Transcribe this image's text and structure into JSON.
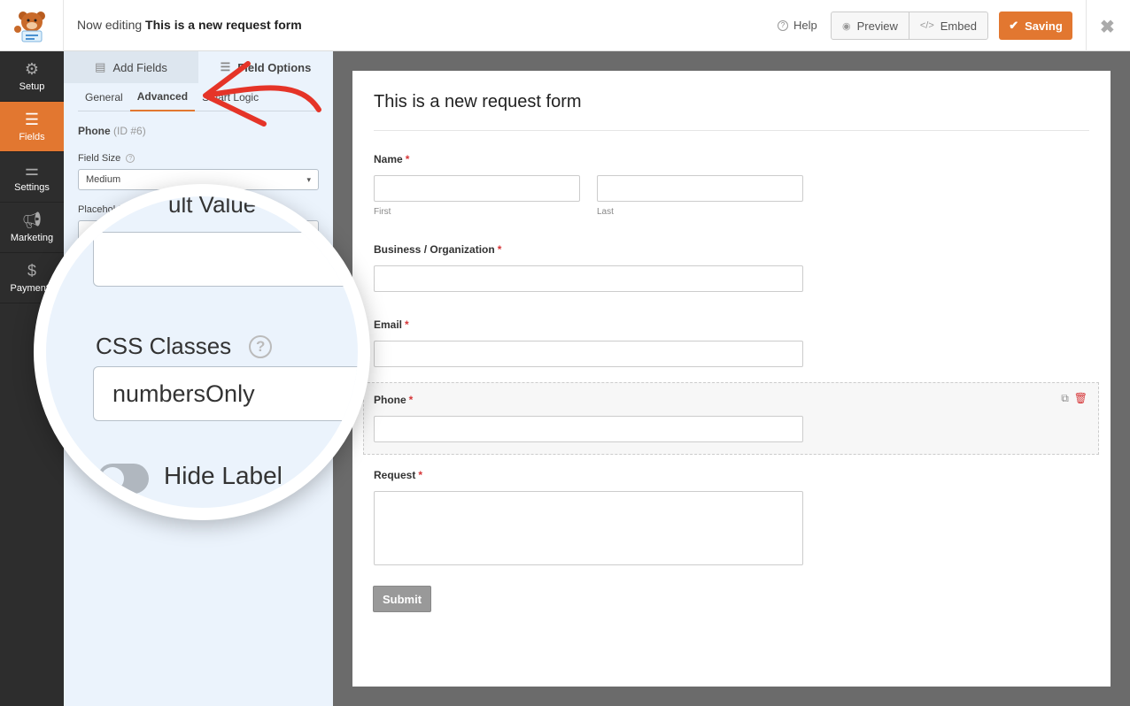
{
  "header": {
    "editing_prefix": "Now editing",
    "form_name": "This is a new request form",
    "help_label": "Help",
    "preview_label": "Preview",
    "embed_label": "Embed",
    "saving_label": "Saving",
    "accent_color": "#e27730"
  },
  "nav": {
    "items": [
      {
        "label": "Setup",
        "icon": "gear-icon"
      },
      {
        "label": "Fields",
        "icon": "fields-icon",
        "active": true
      },
      {
        "label": "Settings",
        "icon": "sliders-icon"
      },
      {
        "label": "Marketing",
        "icon": "megaphone-icon"
      },
      {
        "label": "Payments",
        "icon": "dollar-icon"
      }
    ]
  },
  "panel": {
    "tabs": [
      {
        "label": "Add Fields"
      },
      {
        "label": "Field Options",
        "active": true
      }
    ],
    "subtabs": [
      {
        "label": "General"
      },
      {
        "label": "Advanced",
        "active": true
      },
      {
        "label": "Smart Logic"
      }
    ],
    "field_name": "Phone",
    "field_id": "(ID #6)",
    "field_size_label": "Field Size",
    "field_size_value": "Medium",
    "placeholder_label": "Placeholder Text"
  },
  "magnifier": {
    "partial_text": "ult Value",
    "css_classes_label": "CSS Classes",
    "css_classes_value": "numbersOnly",
    "hide_label": "Hide Label"
  },
  "form": {
    "title": "This is a new request form",
    "fields": {
      "name": {
        "label": "Name",
        "first": "First",
        "last": "Last"
      },
      "business": {
        "label": "Business / Organization"
      },
      "email": {
        "label": "Email"
      },
      "phone": {
        "label": "Phone"
      },
      "request": {
        "label": "Request"
      }
    },
    "required_mark": "*",
    "submit_label": "Submit"
  }
}
